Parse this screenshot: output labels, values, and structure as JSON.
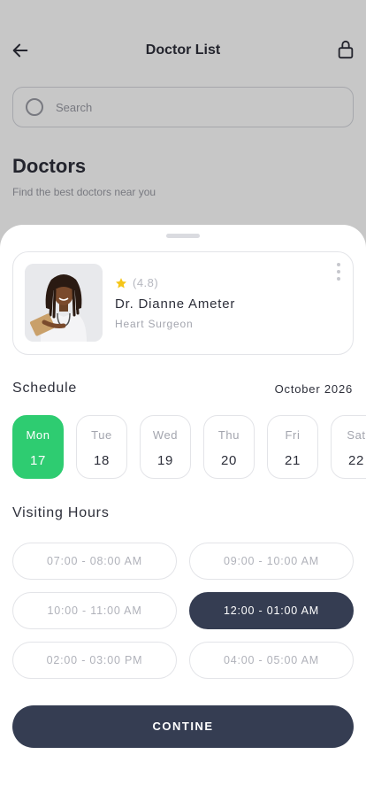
{
  "background": {
    "title": "Doctor List",
    "search_placeholder": "Search",
    "section_title": "Doctors",
    "section_subtitle": "Find the best doctors near you"
  },
  "doctor": {
    "rating": "(4.8)",
    "name": "Dr. Dianne Ameter",
    "specialty": "Heart Surgeon"
  },
  "schedule": {
    "title": "Schedule",
    "month": "October 2026",
    "days": [
      {
        "name": "Mon",
        "num": "17"
      },
      {
        "name": "Tue",
        "num": "18"
      },
      {
        "name": "Wed",
        "num": "19"
      },
      {
        "name": "Thu",
        "num": "20"
      },
      {
        "name": "Fri",
        "num": "21"
      },
      {
        "name": "Sat",
        "num": "22"
      }
    ],
    "selected_day": "17"
  },
  "visiting_hours": {
    "title": "Visiting Hours",
    "slots": [
      "07:00 - 08:00 AM",
      "09:00 - 10:00 AM",
      "10:00 - 11:00 AM",
      "12:00 - 01:00 AM",
      "02:00 - 03:00 PM",
      "04:00 - 05:00 AM"
    ],
    "selected_slot": "12:00 - 01:00 AM"
  },
  "continue_label": "CONTINE",
  "colors": {
    "accent_green": "#2ecc71",
    "primary_dark": "#353d52",
    "star": "#f5c518"
  }
}
